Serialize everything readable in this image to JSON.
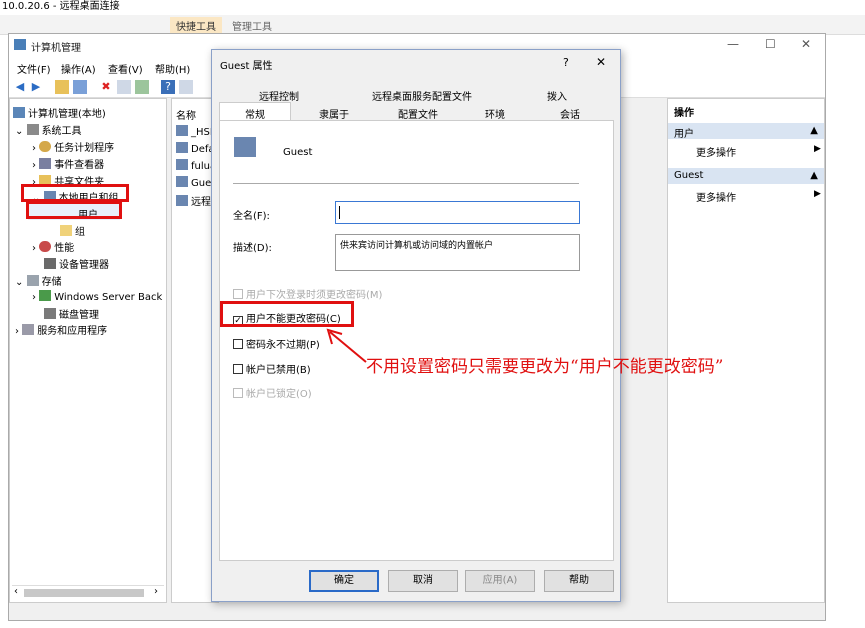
{
  "remote": {
    "title": "10.0.20.6 - 远程桌面连接",
    "quick_tools": "快捷工具",
    "manage_tools": "管理工具"
  },
  "mmc": {
    "title": "计算机管理",
    "menu": {
      "file": "文件(F)",
      "action": "操作(A)",
      "view": "查看(V)",
      "help": "帮助(H)"
    },
    "tree": {
      "root": "计算机管理(本地)",
      "system_tools": "系统工具",
      "task_scheduler": "任务计划程序",
      "event_viewer": "事件查看器",
      "shared_folders": "共享文件夹",
      "local_users": "本地用户和组",
      "users": "用户",
      "groups": "组",
      "performance": "性能",
      "device_manager": "设备管理器",
      "storage": "存储",
      "wsb": "Windows Server Back",
      "disk_mgmt": "磁盘管理",
      "services_apps": "服务和应用程序"
    },
    "list": {
      "header": "名称",
      "items": [
        "_HSI",
        "Defau",
        "fulua",
        "Gues",
        "远程卓"
      ]
    },
    "actions": {
      "header": "操作",
      "sec1": "用户",
      "more1": "更多操作",
      "sec2": "Guest",
      "more2": "更多操作"
    }
  },
  "dialog": {
    "title": "Guest 属性",
    "help": "?",
    "close": "✕",
    "tabs_top": [
      "远程控制",
      "远程桌面服务配置文件",
      "拨入"
    ],
    "tabs_bottom": [
      "常规",
      "隶属于",
      "配置文件",
      "环境",
      "会话"
    ],
    "username": "Guest",
    "fullname_label": "全名(F):",
    "fullname_value": "",
    "desc_label": "描述(D):",
    "desc_value": "供来宾访问计算机或访问域的内置帐户",
    "cb_must_change": "用户下次登录时须更改密码(M)",
    "cb_cannot_change": "用户不能更改密码(C)",
    "cb_never_expire": "密码永不过期(P)",
    "cb_disabled": "帐户已禁用(B)",
    "cb_locked": "帐户已锁定(O)",
    "buttons": {
      "ok": "确定",
      "cancel": "取消",
      "apply": "应用(A)",
      "help": "帮助"
    }
  },
  "annotation": "不用设置密码只需要更改为“用户不能更改密码”",
  "colors": {
    "annotation": "#e01010",
    "dialog_border": "#8aa0c8"
  }
}
